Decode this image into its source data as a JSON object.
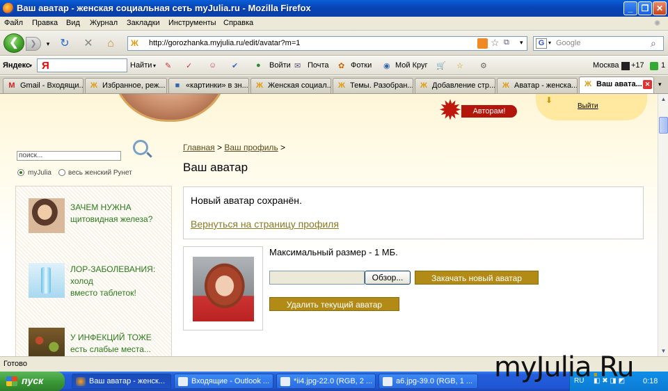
{
  "window": {
    "title": "Ваш аватар - женская социальная сеть myJulia.ru - Mozilla Firefox"
  },
  "menu": [
    "Файл",
    "Правка",
    "Вид",
    "Журнал",
    "Закладки",
    "Инструменты",
    "Справка"
  ],
  "nav": {
    "url": "http://gorozhanka.myjulia.ru/edit/avatar?m=1",
    "search_placeholder": "Google"
  },
  "yandex": {
    "logo": "Яндекс",
    "find": "Найти",
    "login": "Войти",
    "mail": "Почта",
    "photos": "Фотки",
    "mykrug": "Мой Круг",
    "city": "Москва",
    "temp": "+17",
    "count": "1"
  },
  "tabs": [
    {
      "label": "Gmail - Входящи...",
      "icon": "M"
    },
    {
      "label": "Избранное, реж...",
      "icon": "Ж"
    },
    {
      "label": "«картинки» в зн...",
      "icon": "■"
    },
    {
      "label": "Женская социал...",
      "icon": "Ж"
    },
    {
      "label": "Темы. Разобран...",
      "icon": "Ж"
    },
    {
      "label": "Добавление стр...",
      "icon": "Ж"
    },
    {
      "label": "Аватар - женска...",
      "icon": "Ж"
    },
    {
      "label": "Ваш авата...",
      "icon": "Ж"
    }
  ],
  "header": {
    "authors": "Авторам!",
    "logout": "Выйти"
  },
  "sidebar": {
    "search_value": "поиск...",
    "radio1": "myJulia",
    "radio2": "весь женский Рунет",
    "promos": [
      {
        "line1": "ЗАЧЕМ НУЖНА",
        "line2": "щитовидная железа?",
        "line3": ""
      },
      {
        "line1": "ЛОР-ЗАБОЛЕВАНИЯ:",
        "line2": "холод",
        "line3": "вместо таблеток!"
      },
      {
        "line1": "У ИНФЕКЦИЙ ТОЖЕ",
        "line2": "есть слабые места...",
        "line3": ""
      }
    ]
  },
  "main": {
    "breadcrumb": {
      "home": "Главная",
      "sep1": " > ",
      "profile": "Ваш профиль",
      "sep2": " >"
    },
    "title": "Ваш аватар",
    "notice": "Новый аватар сохранён.",
    "back_link": "Вернуться на страницу профиля",
    "max_size": "Максимальный размер - 1 МБ.",
    "browse": "Обзор...",
    "upload": "Закачать новый аватар",
    "delete": "Удалить текущий аватар"
  },
  "status": "Готово",
  "taskbar": {
    "start": "пуск",
    "tasks": [
      "Ваш аватар - женск...",
      "Входящие - Outlook ...",
      "*ii4.jpg-22.0 (RGB, 2 ...",
      "a6.jpg-39.0 (RGB, 1 ..."
    ],
    "lang": "RU",
    "clock": "0:18"
  },
  "watermark": {
    "part1": "myJulia",
    "part2": ".",
    "part3": "Ru"
  }
}
